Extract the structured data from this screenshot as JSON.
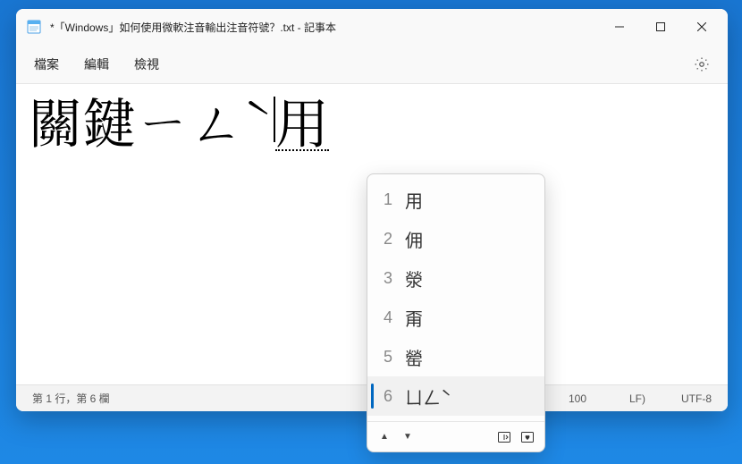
{
  "titlebar": {
    "title": "*「Windows」如何使用微軟注音輸出注音符號？.txt - 記事本"
  },
  "menubar": {
    "file": "檔案",
    "edit": "編輯",
    "view": "檢視"
  },
  "editor": {
    "committed_text": "關鍵ㄧㄥˋ",
    "composition_text": "用"
  },
  "ime": {
    "candidates": [
      {
        "n": "1",
        "c": "用"
      },
      {
        "n": "2",
        "c": "佣"
      },
      {
        "n": "3",
        "c": "滎"
      },
      {
        "n": "4",
        "c": "甭"
      },
      {
        "n": "5",
        "c": "罃"
      },
      {
        "n": "6",
        "c": "ㄩㄥˋ"
      }
    ],
    "active_index": 5
  },
  "statusbar": {
    "position": "第 1 行，第 6 欄",
    "zoom": "100",
    "line_ending": "LF)",
    "encoding": "UTF-8"
  }
}
